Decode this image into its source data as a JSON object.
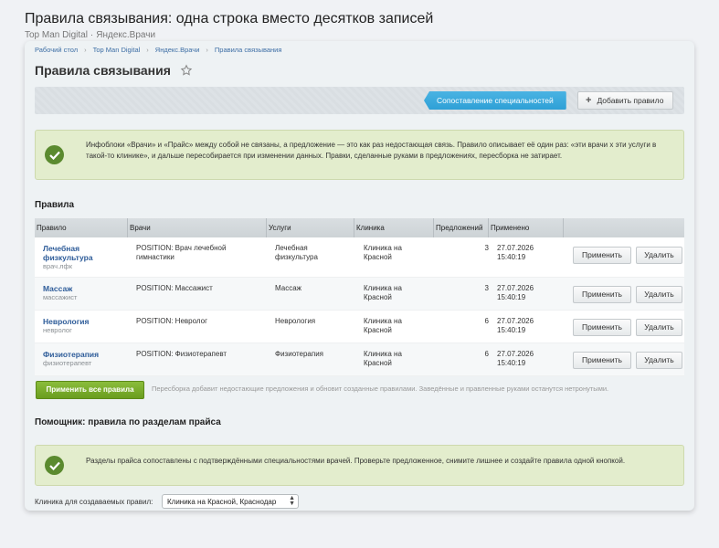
{
  "page": {
    "title": "Правила связывания: одна строка вместо десятков записей",
    "company": "Top Man Digital",
    "separator": "·",
    "project": "Яндекс.Врачи"
  },
  "breadcrumbs": [
    "Рабочий стол",
    "Top Man Digital",
    "Яндекс.Врачи",
    "Правила связывания"
  ],
  "breadcrumb_separator": "›",
  "heading": "Правила связывания",
  "toolbar": {
    "match_button": "Сопоставление специальностей",
    "add_button": "Добавить правило",
    "add_icon": "+"
  },
  "info_note": "Инфоблоки «Врачи» и «Прайс» между собой не связаны, а предложение — это как раз недостающая связь. Правило описывает её один раз: «эти врачи х эти услуги в такой-то клинике», и дальше пересобирается при изменении данных. Правки, сделанные руками в предложениях, пересборка не затирает.",
  "rules_section": "Правила",
  "table": {
    "headers": [
      "Правило",
      "Врачи",
      "Услуги",
      "Клиника",
      "Предложений",
      "Применено"
    ],
    "apply_label": "Применить",
    "delete_label": "Удалить",
    "rows": [
      {
        "name": "Лечебная физкультура",
        "code": "врач.лфк",
        "doctors": "POSITION: Врач лечебной гимнастики",
        "service": "Лечебная физкультура",
        "clinic": "Клиника на Красной",
        "offers": "3",
        "date": "27.07.2026",
        "time": "15:40:19"
      },
      {
        "name": "Массаж",
        "code": "массажист",
        "doctors": "POSITION: Массажист",
        "service": "Массаж",
        "clinic": "Клиника на Красной",
        "offers": "3",
        "date": "27.07.2026",
        "time": "15:40:19"
      },
      {
        "name": "Неврология",
        "code": "невролог",
        "doctors": "POSITION: Невролог",
        "service": "Неврология",
        "clinic": "Клиника на Красной",
        "offers": "6",
        "date": "27.07.2026",
        "time": "15:40:19"
      },
      {
        "name": "Физиотерапия",
        "code": "физиотерапевт",
        "doctors": "POSITION: Физиотерапевт",
        "service": "Физиотерапия",
        "clinic": "Клиника на Красной",
        "offers": "6",
        "date": "27.07.2026",
        "time": "15:40:19"
      }
    ]
  },
  "apply_all": "Применить все правила",
  "apply_hint": "Пересборка добавит недостающие предложения и обновит созданные правилами. Заведённые и правленные руками останутся нетронутыми.",
  "helper_section": "Помощник: правила по разделам прайса",
  "helper_note": "Разделы прайса сопоставлены с подтверждёнными специальностями врачей. Проверьте предложенное, снимите лишнее и создайте правила одной кнопкой.",
  "clinic_filter": {
    "label": "Клиника для создаваемых правил:",
    "value": "Клиника на Красной, Краснодар"
  },
  "colors": {
    "accent_blue": "#2ea0d6",
    "success_green": "#6a9d1e",
    "link": "#2e5c99",
    "note_bg": "#e3edcd"
  }
}
